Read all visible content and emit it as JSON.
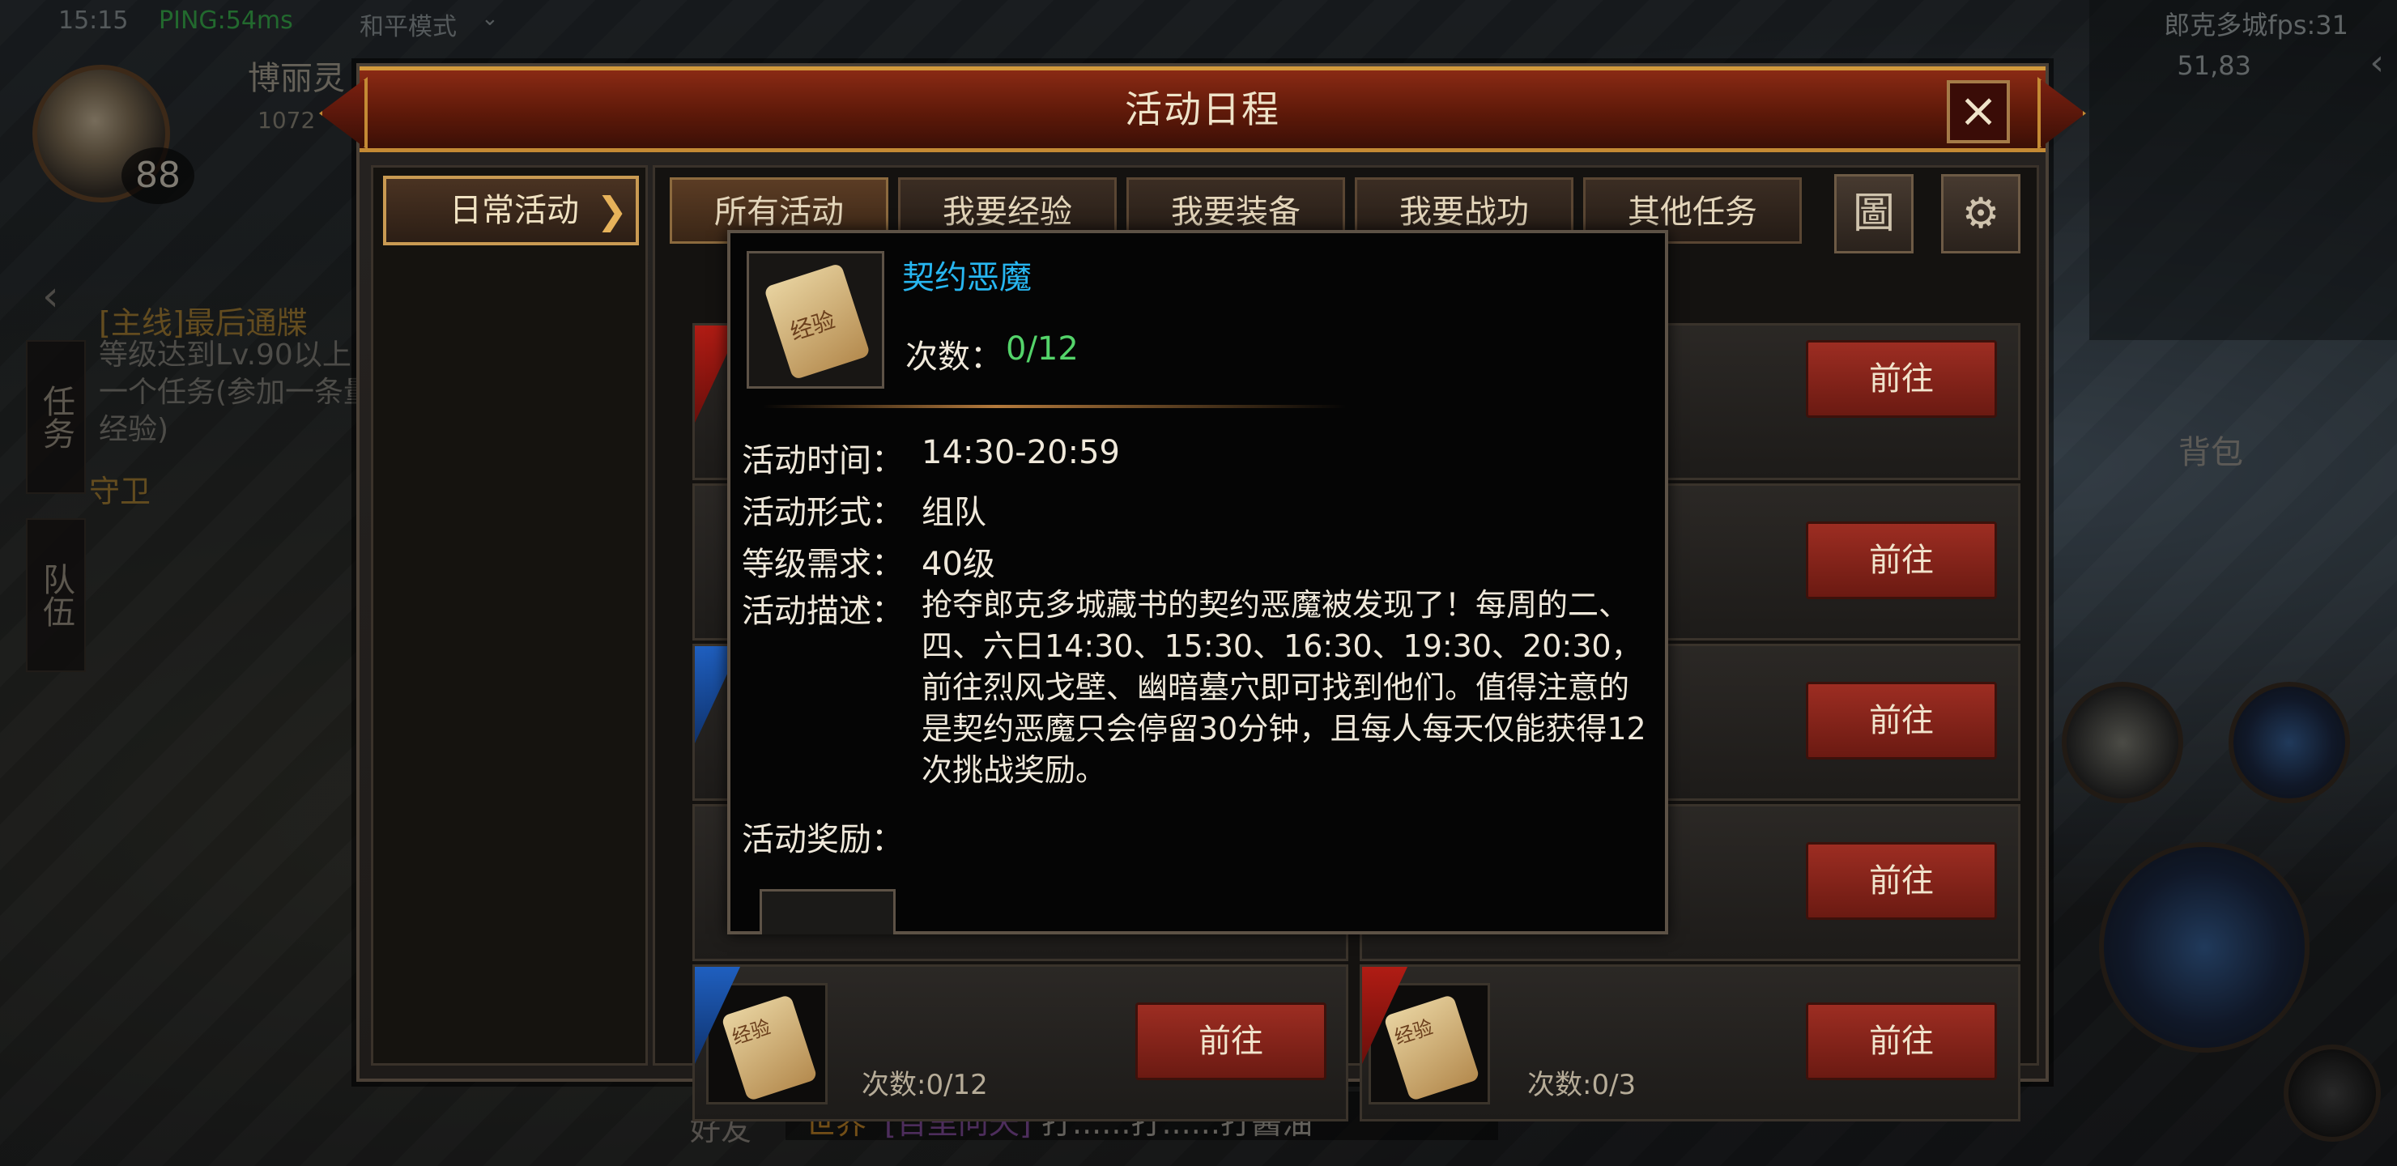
{
  "hud": {
    "time": "15:15",
    "ping": "PING:54ms",
    "mode": "和平模式",
    "player_name": "博丽灵",
    "player_hp": "1072",
    "level": "88",
    "city_fps": "郎克多城fps:31",
    "coords": "51,83",
    "bag_label": "背包",
    "side_tab_task": "任务",
    "side_tab_team": "队伍",
    "quest_title": "[主线]最后通牒",
    "quest_desc": "等级达到Lv.90以上一个任务(参加一条量经验)",
    "quest_guard": "守卫",
    "friends_label": "好友",
    "chat_channel": "世界",
    "chat_sender": "[百里问天]",
    "chat_text": "打......打......打酱油"
  },
  "dialog": {
    "title": "活动日程",
    "close_label": "×",
    "left_menu": {
      "active_label": "日常活动",
      "arrow": "❯"
    },
    "tabs": [
      "所有活动",
      "我要经验",
      "我要装备",
      "我要战功",
      "其他任务"
    ],
    "active_tab_index": 0,
    "calendar_icon": "圖",
    "settings_icon": "⚙",
    "rows": [
      {
        "go_label": "前往",
        "ribbon": "red"
      },
      {
        "go_label": "前往"
      },
      {
        "go_label": "前往",
        "ribbon": "blue"
      },
      {
        "go_label": "前往"
      },
      {
        "go_label": "前往",
        "ribbon": "blue",
        "count": "次数:0/12",
        "item_icon": "经验"
      }
    ],
    "right_column_rows": [
      {
        "go_label": "前往"
      },
      {
        "go_label": "前往"
      },
      {
        "go_label": "前往"
      },
      {
        "go_label": "前往"
      },
      {
        "go_label": "前往",
        "ribbon": "red",
        "count": "次数:0/3",
        "item_icon": "经验"
      }
    ]
  },
  "tooltip": {
    "icon_label": "经验",
    "name": "契约恶魔",
    "count_label": "次数：",
    "count_value": "0/12",
    "time_key": "活动时间：",
    "time_val": "14:30-20:59",
    "form_key": "活动形式：",
    "form_val": "组队",
    "level_key": "等级需求：",
    "level_val": "40级",
    "desc_key": "活动描述：",
    "desc_val": "抢夺郎克多城藏书的契约恶魔被发现了！每周的二、四、六日14:30、15:30、16:30、19:30、20:30，前往烈风戈壁、幽暗墓穴即可找到他们。值得注意的是契约恶魔只会停留30分钟，且每人每天仅能获得12次挑战奖励。",
    "reward_key": "活动奖励："
  }
}
